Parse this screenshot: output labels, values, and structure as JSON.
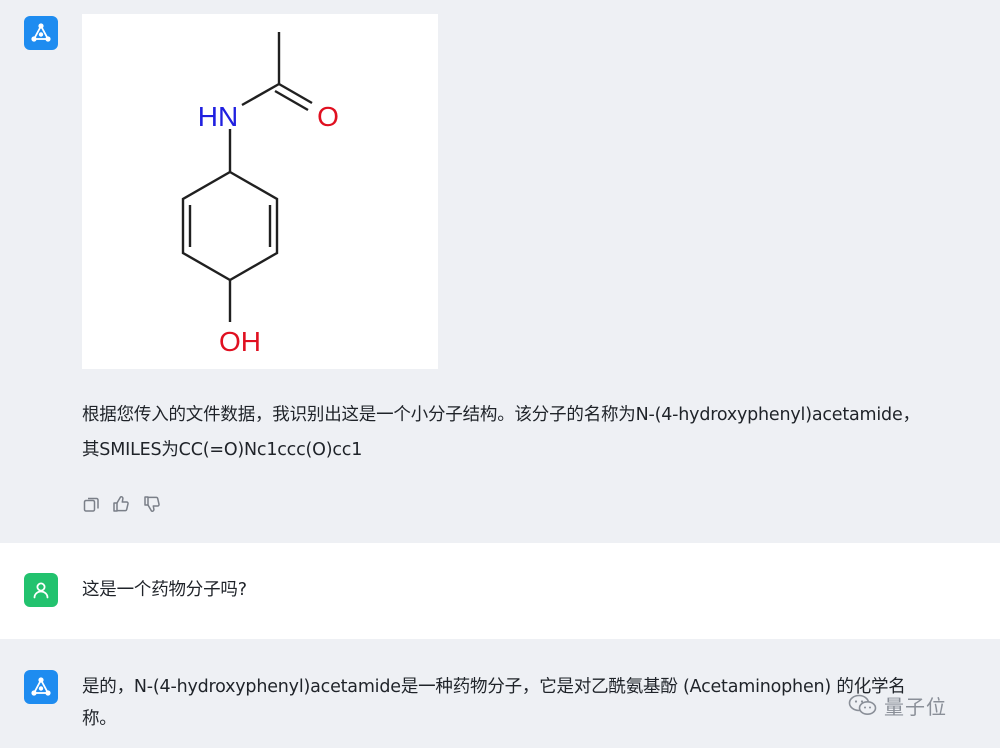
{
  "conversation": {
    "bot_message_1": {
      "molecule": {
        "label_nh": "HN",
        "label_o": "O",
        "label_oh": "OH"
      },
      "line1": "根据您传入的文件数据，我识别出这是一个小分子结构。该分子的名称为N-(4-hydroxyphenyl)acetamide，",
      "line2": "其SMILES为CC(=O)Nc1ccc(O)cc1",
      "actions": [
        "copy-icon",
        "thumbs-up-icon",
        "thumbs-down-icon"
      ]
    },
    "user_message": {
      "text": "这是一个药物分子吗?"
    },
    "bot_message_2": {
      "line1": "是的，N-(4-hydroxyphenyl)acetamide是一种药物分子，它是对乙酰氨基酚 (Acetaminophen) 的化学名",
      "line2": "称。"
    }
  },
  "watermark": {
    "text": "量子位"
  },
  "colors": {
    "bot_avatar": "#1e8cf0",
    "user_avatar": "#22c26e",
    "nitrogen": "#2020e0",
    "oxygen": "#e01020",
    "bond": "#202020"
  }
}
